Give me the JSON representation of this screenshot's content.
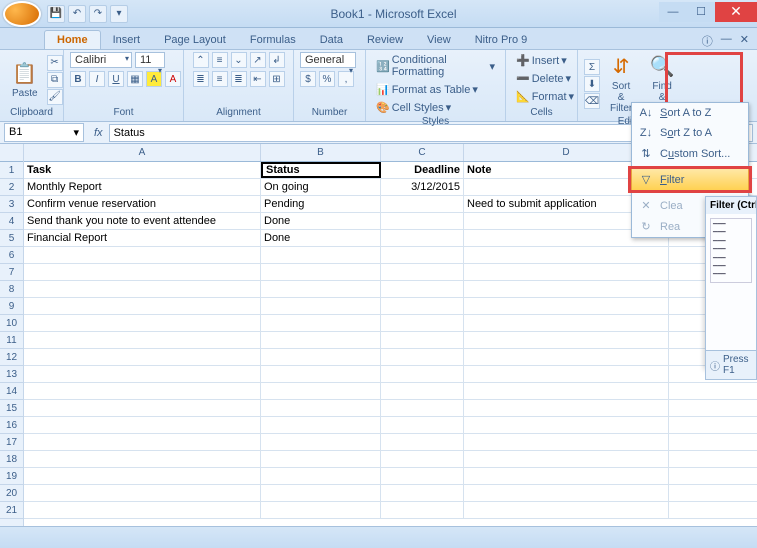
{
  "window": {
    "title": "Book1 - Microsoft Excel"
  },
  "qat": {
    "save": "💾",
    "undo": "↶",
    "redo": "↷"
  },
  "tabs": [
    "Home",
    "Insert",
    "Page Layout",
    "Formulas",
    "Data",
    "Review",
    "View",
    "Nitro Pro 9"
  ],
  "ribbon": {
    "clipboard": {
      "label": "Clipboard",
      "paste": "Paste"
    },
    "font": {
      "label": "Font",
      "name": "Calibri",
      "size": "11"
    },
    "alignment": {
      "label": "Alignment"
    },
    "number": {
      "label": "Number",
      "format": "General"
    },
    "styles": {
      "label": "Styles",
      "cond": "Conditional Formatting",
      "table": "Format as Table",
      "cell": "Cell Styles"
    },
    "cells": {
      "label": "Cells",
      "insert": "Insert",
      "delete": "Delete",
      "format": "Format"
    },
    "editing": {
      "label": "Editing",
      "sort": "Sort & Filter",
      "find": "Find & Select"
    }
  },
  "namebox": "B1",
  "formula": "Status",
  "columns": [
    "A",
    "B",
    "C",
    "D"
  ],
  "rows": [
    {
      "a": "Task",
      "b": "Status",
      "c": "Deadline",
      "d": "Note",
      "bold": true
    },
    {
      "a": "Monthly Report",
      "b": "On going",
      "c": "3/12/2015",
      "d": ""
    },
    {
      "a": "Confirm venue reservation",
      "b": "Pending",
      "c": "",
      "d": "Need to submit application"
    },
    {
      "a": "Send thank you note to event attendee",
      "b": "Done",
      "c": "",
      "d": ""
    },
    {
      "a": "Financial Report",
      "b": "Done",
      "c": "",
      "d": ""
    }
  ],
  "dropdown": {
    "sortAZ": "Sort A to Z",
    "sortZA": "Sort Z to A",
    "custom": "Custom Sort...",
    "filter": "Filter",
    "clear": "Clea",
    "reapply": "Rea"
  },
  "tooltip": {
    "title": "Filter (Ctrl+S"
  },
  "help": "Press F1"
}
